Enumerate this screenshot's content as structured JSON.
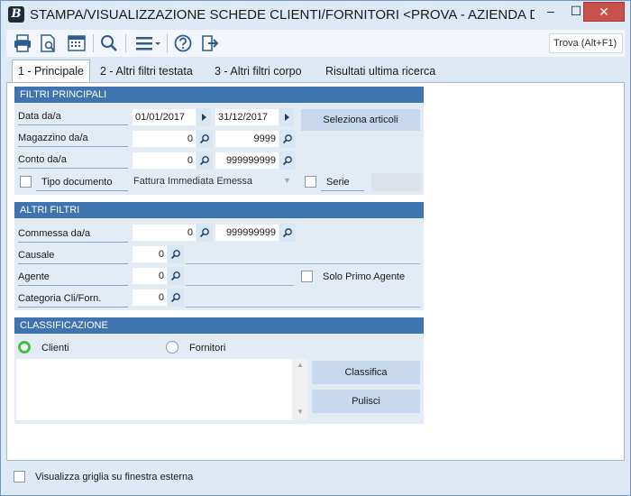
{
  "window": {
    "title": "STAMPA/VISUALIZZAZIONE SCHEDE CLIENTI/FORNITORI <PROVA - AZIENDA DI P...",
    "app_icon": "B",
    "controls": {
      "minimize": "–",
      "maximize": "☐",
      "close": "✕"
    }
  },
  "toolbar": {
    "icons": [
      "printer-icon",
      "print-preview-icon",
      "calendar-grid-icon",
      "search-icon",
      "menu-icon",
      "help-icon",
      "exit-icon"
    ],
    "find_label": "Trova (Alt+F1)"
  },
  "tabs": [
    {
      "label": "1 - Principale",
      "active": true
    },
    {
      "label": "2 - Altri filtri testata",
      "active": false
    },
    {
      "label": "3 - Altri filtri corpo",
      "active": false
    },
    {
      "label": "Risultati ultima ricerca",
      "active": false
    }
  ],
  "filtri_principali": {
    "header": "FILTRI PRINCIPALI",
    "data_label": "Data da/a",
    "data_from": "01/01/2017",
    "data_to": "31/12/2017",
    "seleziona_button": "Seleziona articoli",
    "magazzino_label": "Magazzino da/a",
    "magazzino_from": "0",
    "magazzino_to": "9999",
    "conto_label": "Conto da/a",
    "conto_from": "0",
    "conto_to": "999999999",
    "tipo_documento_label": "Tipo documento",
    "tipo_documento_value": "Fattura Immediata Emessa",
    "serie_label": "Serie"
  },
  "altri_filtri": {
    "header": "ALTRI FILTRI",
    "commessa_label": "Commessa da/a",
    "commessa_from": "0",
    "commessa_to": "999999999",
    "causale_label": "Causale",
    "causale_value": "0",
    "agente_label": "Agente",
    "agente_value": "0",
    "solo_primo_agente_label": "Solo Primo Agente",
    "categoria_label": "Categoria Cli/Forn.",
    "categoria_value": "0"
  },
  "classificazione": {
    "header": "CLASSIFICAZIONE",
    "clienti_label": "Clienti",
    "fornitori_label": "Fornitori",
    "selected": "Clienti",
    "classifica_button": "Classifica",
    "pulisci_button": "Pulisci"
  },
  "footer": {
    "griglia_label": "Visualizza griglia su finestra esterna"
  },
  "colors": {
    "panel_header": "#3f74b1",
    "panel_bg": "#e3ebf5",
    "button_bg": "#c7d8ee",
    "radio_on": "#3ec43e",
    "close_button": "#c7504a"
  }
}
